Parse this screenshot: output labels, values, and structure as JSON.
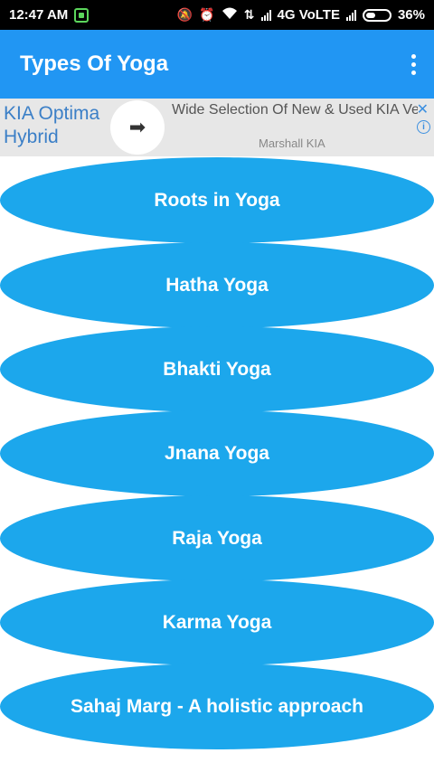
{
  "status_bar": {
    "time": "12:47 AM",
    "network": "4G VoLTE",
    "battery": "36%",
    "icons": [
      "app-notification-icon",
      "mute-icon",
      "alarm-icon",
      "wifi-icon",
      "data-transfer-icon",
      "signal-icon",
      "signal-icon",
      "battery-icon"
    ]
  },
  "app_bar": {
    "title": "Types Of Yoga",
    "menu_icon": "overflow-menu-icon"
  },
  "ad": {
    "title": "KIA Optima Hybrid",
    "description": "Wide Selection Of New & Used KIA Vehicles - Speak To An Expert Today",
    "source": "Marshall KIA",
    "arrow_glyph": "➡",
    "close_glyph": "✕",
    "info_glyph": "i"
  },
  "yoga_types": [
    {
      "label": "Roots in Yoga"
    },
    {
      "label": "Hatha Yoga"
    },
    {
      "label": "Bhakti Yoga"
    },
    {
      "label": "Jnana Yoga"
    },
    {
      "label": "Raja Yoga"
    },
    {
      "label": "Karma Yoga"
    },
    {
      "label": "Sahaj Marg - A holistic approach"
    }
  ],
  "colors": {
    "status_bar": "#000000",
    "app_bar": "#2196f3",
    "button": "#1ca7ec",
    "ad_background": "#e7e7e7"
  }
}
